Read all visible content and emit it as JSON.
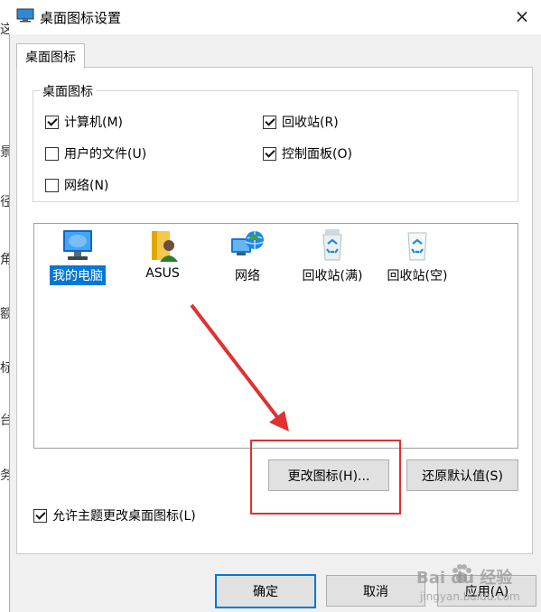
{
  "background_window": {
    "chars": [
      "这",
      "景",
      "径",
      "角",
      "额",
      "标",
      "台",
      "务"
    ]
  },
  "dialog": {
    "title": "桌面图标设置",
    "close_icon": "×",
    "tab_label": "桌面图标",
    "group_title": "桌面图标",
    "checkboxes": [
      {
        "label": "计算机(M)",
        "checked": true
      },
      {
        "label": "回收站(R)",
        "checked": true
      },
      {
        "label": "用户的文件(U)",
        "checked": false
      },
      {
        "label": "控制面板(O)",
        "checked": true
      },
      {
        "label": "网络(N)",
        "checked": false
      }
    ],
    "icons": [
      {
        "label": "我的电脑",
        "icon": "computer-icon",
        "selected": true
      },
      {
        "label": "ASUS",
        "icon": "user-folder-icon",
        "selected": false
      },
      {
        "label": "网络",
        "icon": "network-icon",
        "selected": false
      },
      {
        "label": "回收站(满)",
        "icon": "recycle-bin-full-icon",
        "selected": false
      },
      {
        "label": "回收站(空)",
        "icon": "recycle-bin-empty-icon",
        "selected": false
      }
    ],
    "change_icon_button": "更改图标(H)...",
    "restore_default_button": "还原默认值(S)",
    "allow_theme_checkbox": {
      "label": "允许主题更改桌面图标(L)",
      "checked": true
    },
    "ok_button": "确定",
    "cancel_button": "取消",
    "apply_button": "应用(A)"
  },
  "watermark": {
    "brand": "Bai du 经验",
    "url": "jingyan.baidu.com"
  },
  "colors": {
    "accent": "#0078d7",
    "annotation": "#e03131"
  }
}
